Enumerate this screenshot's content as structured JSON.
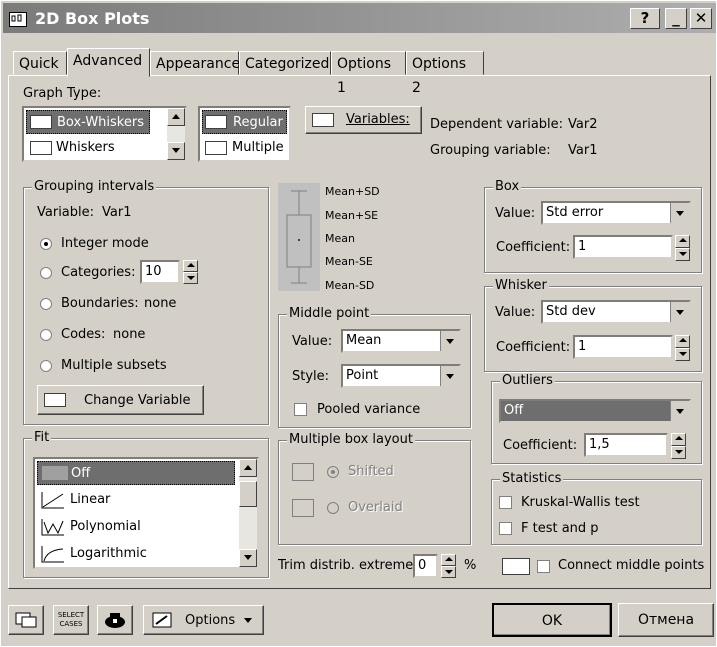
{
  "window": {
    "title": "2D Box Plots",
    "help_label": "?",
    "min_label": "_",
    "close_label": "✕"
  },
  "tabs": [
    {
      "label": "Quick"
    },
    {
      "label": "Advanced"
    },
    {
      "label": "Appearance"
    },
    {
      "label": "Categorized"
    },
    {
      "label": "Options 1"
    },
    {
      "label": "Options 2"
    }
  ],
  "graph_type": {
    "label": "Graph Type:",
    "types": [
      "Box-Whiskers",
      "Whiskers"
    ],
    "regular_label": "Regular",
    "multiple_label": "Multiple",
    "variables_label": "Variables:",
    "dependent_label": "Dependent variable:",
    "dependent_value": "Var2",
    "grouping_label": "Grouping variable:",
    "grouping_value": "Var1"
  },
  "grouping_intervals": {
    "label": "Grouping intervals",
    "variable_label": "Variable:",
    "variable_value": "Var1",
    "integer_mode": "Integer mode",
    "categories": "Categories:",
    "categories_value": "10",
    "boundaries": "Boundaries:",
    "boundaries_value": "none",
    "codes": "Codes:",
    "codes_value": "none",
    "multiple_subsets": "Multiple subsets",
    "change_variable": "Change Variable"
  },
  "preview": {
    "labels": [
      "Mean+SD",
      "Mean+SE",
      "Mean",
      "Mean-SE",
      "Mean-SD"
    ]
  },
  "middle_point": {
    "label": "Middle point",
    "value_label": "Value:",
    "value": "Mean",
    "style_label": "Style:",
    "style": "Point",
    "pooled_variance": "Pooled variance"
  },
  "multiple_box_layout": {
    "label": "Multiple box layout",
    "shifted": "Shifted",
    "overlaid": "Overlaid"
  },
  "box": {
    "label": "Box",
    "value_label": "Value:",
    "value": "Std error",
    "coefficient_label": "Coefficient:",
    "coefficient": "1"
  },
  "whisker": {
    "label": "Whisker",
    "value_label": "Value:",
    "value": "Std dev",
    "coefficient_label": "Coefficient:",
    "coefficient": "1"
  },
  "outliers": {
    "label": "Outliers",
    "value": "Off",
    "coefficient_label": "Coefficient:",
    "coefficient": "1,5"
  },
  "statistics": {
    "label": "Statistics",
    "kruskal": "Kruskal-Wallis test",
    "ftest": "F test and p"
  },
  "fit": {
    "label": "Fit",
    "items": [
      "Off",
      "Linear",
      "Polynomial",
      "Logarithmic"
    ]
  },
  "trim": {
    "label": "Trim distrib. extremes:",
    "value": "0",
    "unit": "%",
    "connect_label": "Connect middle points"
  },
  "bottom": {
    "select_cases_line1": "SELECT",
    "select_cases_line2": "CASES",
    "options_label": "Options",
    "ok_label": "OK",
    "cancel_label": "Отмена"
  }
}
